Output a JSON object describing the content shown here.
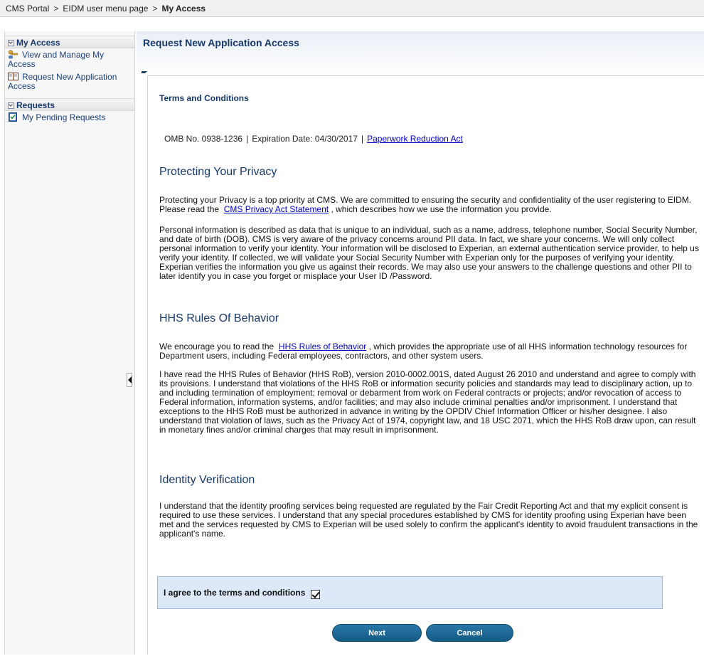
{
  "breadcrumb": {
    "items": [
      "CMS Portal",
      "EIDM user menu page",
      "My Access"
    ],
    "separator": ">"
  },
  "sidebar": {
    "sections": [
      {
        "title": "My Access",
        "items": [
          {
            "label": "View and Manage My Access",
            "icon": "key-user-icon"
          },
          {
            "label": "Request New Application Access",
            "icon": "book-icon"
          }
        ]
      },
      {
        "title": "Requests",
        "items": [
          {
            "label": "My Pending Requests",
            "icon": "checklist-icon"
          }
        ]
      }
    ]
  },
  "page": {
    "title": "Request New Application Access",
    "terms_title": "Terms and Conditions",
    "omb": {
      "number": "OMB No. 0938-1236",
      "expiration": "Expiration Date: 04/30/2017",
      "link": "Paperwork Reduction Act"
    },
    "privacy": {
      "heading": "Protecting Your Privacy",
      "p1_before": "Protecting your Privacy is a top priority at CMS. We are committed to ensuring the security and confidentiality of the user registering to EIDM. Please read the",
      "p1_link": "CMS Privacy Act Statement",
      "p1_after": ", which describes how we use the information you provide.",
      "p2": "Personal information is described as data that is unique to an individual, such as a name, address, telephone number, Social Security Number, and date of birth (DOB). CMS is very aware of the privacy concerns around PII data. In fact, we share your concerns. We will only collect personal information to verify your identity. Your information will be disclosed to Experian, an external authentication service provider, to help us verify your identity. If collected, we will validate your Social Security Number with Experian only for the purposes of verifying your identity. Experian verifies the information you give us against their records. We may also use your answers to the challenge questions and other PII to later identify you in case you forget or misplace your User ID /Password."
    },
    "hhs": {
      "heading": "HHS Rules Of Behavior",
      "p1_before": "We encourage you to read the",
      "p1_link": "HHS Rules of Behavior",
      "p1_after": ", which provides the appropriate use of all HHS information technology resources for Department users, including Federal employees, contractors, and other system users.",
      "p2": "I have read the HHS Rules of Behavior (HHS RoB), version 2010-0002.001S, dated August 26 2010 and understand and agree to comply with its provisions. I understand that violations of the HHS RoB or information security policies and standards may lead to disciplinary action, up to and including termination of employment; removal or debarment from work on Federal contracts or projects; and/or revocation of access to Federal information, information systems, and/or facilities; and may also include criminal penalties and/or imprisonment. I understand that exceptions to the HHS RoB must be authorized in advance in writing by the OPDIV Chief Information Officer or his/her designee. I also understand that violation of laws, such as the Privacy Act of 1974, copyright law, and 18 USC 2071, which the HHS RoB draw upon, can result in monetary fines and/or criminal charges that may result in imprisonment."
    },
    "identity": {
      "heading": "Identity Verification",
      "p1": "I understand that the identity proofing services being requested are regulated by the Fair Credit Reporting Act and that my explicit consent is required to use these services. I understand that any special procedures established by CMS for identity proofing using Experian have been met and the services requested by CMS to Experian will be used solely to confirm the applicant's identity to avoid fraudulent transactions in the applicant's name."
    },
    "agree_label": "I agree to the terms and conditions",
    "agree_checked": true,
    "buttons": {
      "next": "Next",
      "cancel": "Cancel"
    }
  },
  "colors": {
    "heading": "#173a6e",
    "link": "#0000cc",
    "button": "#1b6796",
    "agree_bg": "#dde9f8"
  }
}
